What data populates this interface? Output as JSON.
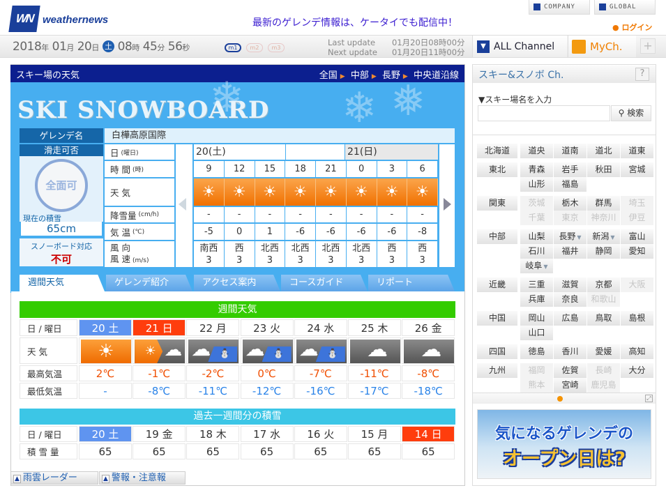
{
  "header": {
    "logo_text": "weathernews",
    "logo_mark": "WN",
    "promo": "最新のゲレンデ情報は、ケータイでも配信中！",
    "company": "COMPANY",
    "global": "GLOBAL",
    "login": "ログイン"
  },
  "clock": {
    "year": "2018",
    "month": "01",
    "day": "20",
    "dow": "土",
    "hour": "08",
    "min": "45",
    "sec": "56",
    "u_year": "年",
    "u_month": "月",
    "u_day": "日",
    "u_hour": "時",
    "u_min": "分",
    "u_sec": "秒",
    "modes": [
      "m1",
      "m2",
      "m3"
    ]
  },
  "update": {
    "last_label": "Last update",
    "last_value": "01月20日08時00分",
    "next_label": "Next update",
    "next_value": "01月20日11時00分"
  },
  "channels": {
    "all": "ALL Channel",
    "my": "MyCh.",
    "plus": "+"
  },
  "main": {
    "title": "スキー場の天気",
    "breadcrumb": [
      "全国",
      "中部",
      "長野",
      "中央道沿線"
    ],
    "banner": "SKI SNOWBOARD"
  },
  "resort": {
    "name_label": "ゲレンデ名",
    "name": "白樺高原国際",
    "status_label": "滑走可否",
    "status": "全面可",
    "snow_label": "現在の積雪",
    "snow": "65cm",
    "snowboard_label": "スノーボード対応",
    "snowboard": "不可"
  },
  "hourly": {
    "labels": {
      "date": "日",
      "date_unit": "(曜日)",
      "time": "時 間",
      "time_unit": "(時)",
      "weather": "天 気",
      "snowfall": "降雪量",
      "snowfall_unit": "(cm/h)",
      "temp": "気 温",
      "temp_unit": "(℃)",
      "wind1": "風 向",
      "wind2": "風 速",
      "wind_unit": "(m/s)"
    },
    "days": [
      "20(土)",
      "21(日)"
    ],
    "hours": [
      "9",
      "12",
      "15",
      "18",
      "21",
      "0",
      "3",
      "6"
    ],
    "weather": [
      "sunny",
      "sunny",
      "sunny",
      "sunny",
      "sunny",
      "sunny",
      "sunny",
      "sunny"
    ],
    "snowfall": [
      "-",
      "-",
      "-",
      "-",
      "-",
      "-",
      "-",
      "-"
    ],
    "temp": [
      "-5",
      "0",
      "1",
      "-6",
      "-6",
      "-6",
      "-6",
      "-8"
    ],
    "wind_dir": [
      "南西",
      "西",
      "北西",
      "北西",
      "北西",
      "北西",
      "西",
      "西"
    ],
    "wind_speed": [
      "3",
      "3",
      "3",
      "3",
      "3",
      "3",
      "3",
      "3"
    ]
  },
  "tabs": [
    "週間天気",
    "ゲレンデ紹介",
    "アクセス案内",
    "コースガイド",
    "リポート"
  ],
  "weekly": {
    "title": "週間天気",
    "labels": [
      "日 / 曜日",
      "天 気",
      "最高気温",
      "最低気温"
    ],
    "days": [
      {
        "d": "20 土",
        "t": "sat",
        "w": "sun",
        "hi": "2℃",
        "lo": "-"
      },
      {
        "d": "21 日",
        "t": "sun",
        "w": "sun-cloud",
        "hi": "-1℃",
        "lo": "-8℃"
      },
      {
        "d": "22 月",
        "t": "",
        "w": "cloud-snow",
        "hi": "-2℃",
        "lo": "-11℃"
      },
      {
        "d": "23 火",
        "t": "",
        "w": "cloud-snow",
        "hi": "0℃",
        "lo": "-12℃"
      },
      {
        "d": "24 水",
        "t": "",
        "w": "cloud-snow",
        "hi": "-7℃",
        "lo": "-16℃"
      },
      {
        "d": "25 木",
        "t": "",
        "w": "cloud",
        "hi": "-11℃",
        "lo": "-17℃"
      },
      {
        "d": "26 金",
        "t": "",
        "w": "cloud",
        "hi": "-8℃",
        "lo": "-18℃"
      }
    ]
  },
  "past": {
    "title": "過去一週間分の積雪",
    "labels": [
      "日 / 曜日",
      "積 雪 量"
    ],
    "days": [
      {
        "d": "20 土",
        "t": "sat",
        "v": "65"
      },
      {
        "d": "19 金",
        "t": "",
        "v": "65"
      },
      {
        "d": "18 木",
        "t": "",
        "v": "65"
      },
      {
        "d": "17 水",
        "t": "",
        "v": "65"
      },
      {
        "d": "16 火",
        "t": "",
        "v": "65"
      },
      {
        "d": "15 月",
        "t": "",
        "v": "65"
      },
      {
        "d": "14 日",
        "t": "sun",
        "v": "65"
      }
    ]
  },
  "bottom_tabs": [
    "雨雲レーダー",
    "警報・注意報"
  ],
  "sidebar": {
    "title": "スキー&スノボ Ch.",
    "help": "?",
    "search_label": "▼スキー場名を入力",
    "search_value": "",
    "search_button": "検索",
    "regions": [
      {
        "name": "北海道",
        "prefs": [
          [
            "道央"
          ],
          [
            "道南"
          ],
          [
            "道北"
          ],
          [
            "道東"
          ]
        ]
      },
      {
        "name": "東北",
        "prefs": [
          [
            "青森"
          ],
          [
            "岩手"
          ],
          [
            "秋田"
          ],
          [
            "宮城"
          ],
          [
            "山形"
          ],
          [
            "福島"
          ]
        ]
      },
      {
        "name": "関東",
        "prefs": [
          [
            "茨城",
            "d"
          ],
          [
            "栃木"
          ],
          [
            "群馬"
          ],
          [
            "埼玉",
            "d"
          ],
          [
            "千葉",
            "d"
          ],
          [
            "東京",
            "d"
          ],
          [
            "神奈川",
            "d"
          ],
          [
            "伊豆",
            "d"
          ]
        ]
      },
      {
        "name": "中部",
        "prefs": [
          [
            "山梨"
          ],
          [
            "長野",
            "m"
          ],
          [
            "新潟",
            "m"
          ],
          [
            "富山"
          ],
          [
            "石川"
          ],
          [
            "福井"
          ],
          [
            "静岡"
          ],
          [
            "愛知"
          ],
          [
            "岐阜",
            "m"
          ]
        ]
      },
      {
        "name": "近畿",
        "prefs": [
          [
            "三重"
          ],
          [
            "滋賀"
          ],
          [
            "京都"
          ],
          [
            "大阪",
            "d"
          ],
          [
            "兵庫"
          ],
          [
            "奈良"
          ],
          [
            "和歌山",
            "d"
          ]
        ]
      },
      {
        "name": "中国",
        "prefs": [
          [
            "岡山"
          ],
          [
            "広島"
          ],
          [
            "鳥取"
          ],
          [
            "島根"
          ],
          [
            "山口"
          ]
        ]
      },
      {
        "name": "四国",
        "prefs": [
          [
            "徳島"
          ],
          [
            "香川"
          ],
          [
            "愛媛"
          ],
          [
            "高知"
          ]
        ]
      },
      {
        "name": "九州",
        "prefs": [
          [
            "福岡",
            "d"
          ],
          [
            "佐賀"
          ],
          [
            "長崎",
            "d"
          ],
          [
            "大分"
          ],
          [
            "熊本",
            "d"
          ],
          [
            "宮崎"
          ],
          [
            "鹿児島",
            "d"
          ]
        ]
      }
    ],
    "ad_line1": "気になるゲレンデの",
    "ad_line2": "オープン日は?"
  },
  "colors": {
    "brand": "#1a3f9a",
    "header_navy": "#0c1f8f",
    "sky": "#47aef0",
    "green": "#33cc00",
    "cyan": "#3cc6e6",
    "sat": "#5f94f0",
    "sun": "#ff3d0d",
    "hi": "#f04e00",
    "lo": "#2a83e8"
  }
}
